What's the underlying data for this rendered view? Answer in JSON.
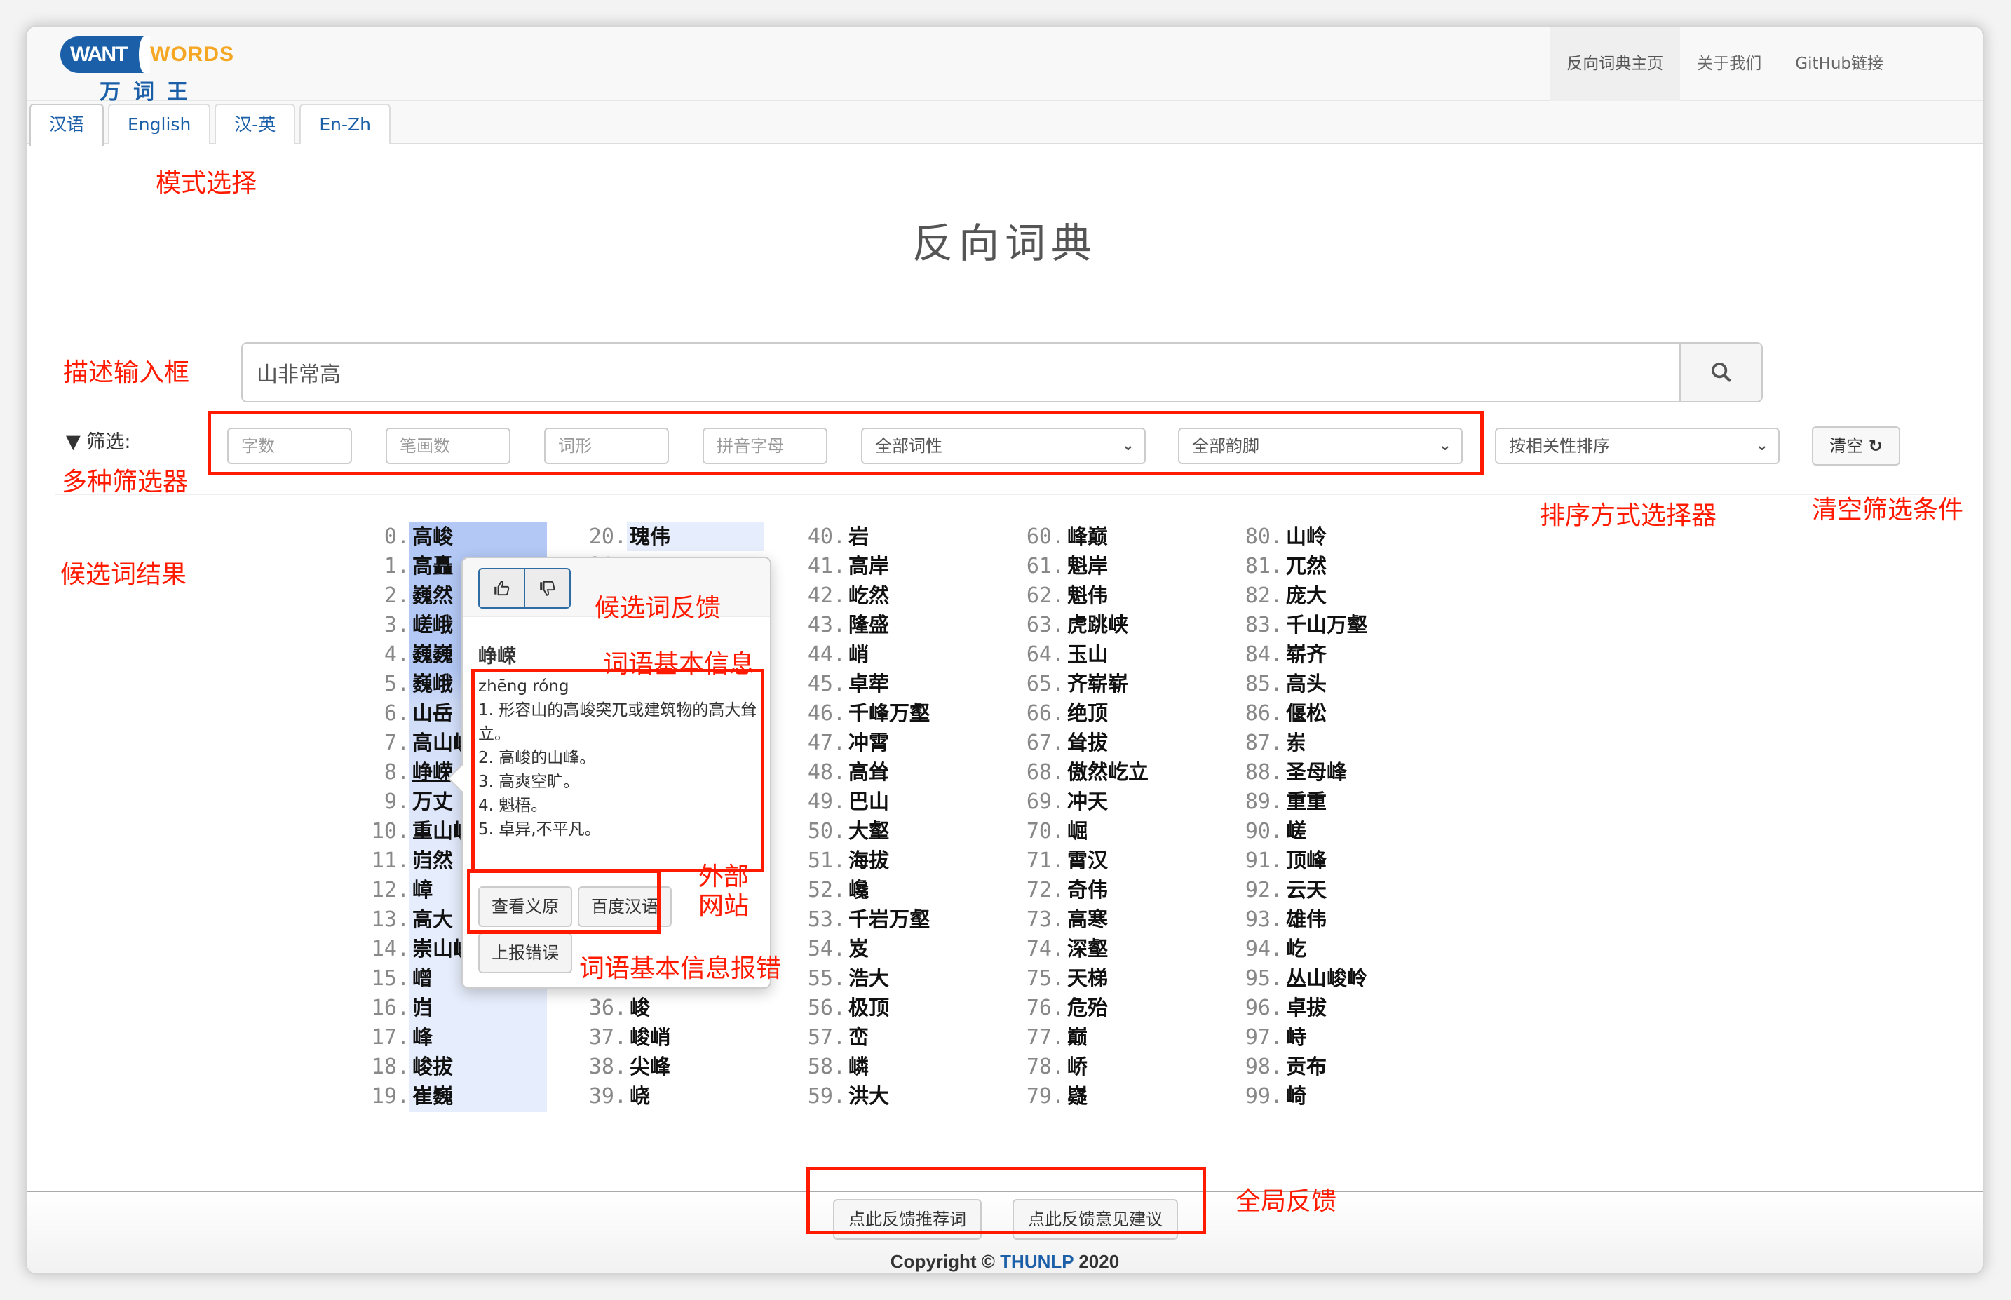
{
  "navbar": {
    "logo": {
      "word1": "WANT",
      "word2": "WORDS",
      "cn": "万词王"
    },
    "links": [
      {
        "label": "反向词典主页",
        "active": true
      },
      {
        "label": "关于我们",
        "active": false
      },
      {
        "label": "GitHub链接",
        "active": false
      }
    ]
  },
  "tabs": [
    {
      "label": "汉语",
      "active": true
    },
    {
      "label": "English",
      "active": false
    },
    {
      "label": "汉-英",
      "active": false
    },
    {
      "label": "En-Zh",
      "active": false
    }
  ],
  "page_title": "反向词典",
  "search": {
    "value": "山非常高",
    "placeholder": "",
    "icon": "search-icon"
  },
  "filters": {
    "label": "筛选:",
    "char_count_placeholder": "字数",
    "stroke_count_placeholder": "笔画数",
    "word_form_placeholder": "词形",
    "pinyin_placeholder": "拼音字母",
    "pos_select": "全部词性",
    "rhyme_select": "全部韵脚",
    "sort_select": "按相关性排序",
    "clear_label": "清空"
  },
  "results": {
    "columns": [
      [
        "高峻",
        "高矗",
        "巍然",
        "嵯峨",
        "巍巍",
        "巍峨",
        "山岳",
        "高山峻岭",
        "峥嵘",
        "万丈",
        "重山峻岭",
        "岿然",
        "嶂",
        "高大",
        "崇山峻岭",
        "嶒",
        "岿",
        "峰",
        "峻拔",
        "崔巍"
      ],
      [
        "瑰伟",
        "",
        "",
        "",
        "",
        "",
        "",
        "",
        "",
        "",
        "",
        "",
        "",
        "",
        "",
        "",
        "峻",
        "峻峭",
        "尖峰",
        "峣"
      ],
      [
        "岩",
        "高岸",
        "屹然",
        "隆盛",
        "峭",
        "卓荦",
        "千峰万壑",
        "冲霄",
        "高耸",
        "巴山",
        "大壑",
        "海拔",
        "巉",
        "千岩万壑",
        "岌",
        "浩大",
        "极顶",
        "峦",
        "嶙",
        "洪大"
      ],
      [
        "峰巅",
        "魁岸",
        "魁伟",
        "虎跳峡",
        "玉山",
        "齐崭崭",
        "绝顶",
        "耸拔",
        "傲然屹立",
        "冲天",
        "崛",
        "霄汉",
        "奇伟",
        "高寒",
        "深壑",
        "天梯",
        "危殆",
        "巅",
        "峤",
        "嶷"
      ],
      [
        "山岭",
        "兀然",
        "庞大",
        "千山万壑",
        "崭齐",
        "高头",
        "偃松",
        "岽",
        "圣母峰",
        "重重",
        "嵯",
        "顶峰",
        "云天",
        "雄伟",
        "屹",
        "丛山峻岭",
        "卓拔",
        "峙",
        "贡布",
        "崎"
      ]
    ],
    "selected_index": 8
  },
  "popover": {
    "vote_up_icon": "thumbs-up-icon",
    "vote_down_icon": "thumbs-down-icon",
    "word": "峥嵘",
    "pinyin": "zhēng róng",
    "definitions": [
      "1. 形容山的高峻突兀或建筑物的高大耸立。",
      "2. 高峻的山峰。",
      "3. 高爽空旷。",
      "4. 魁梧。",
      "5. 卓异,不平凡。"
    ],
    "source_button": "查看义原",
    "baidu_button": "百度汉语",
    "report_button": "上报错误"
  },
  "footer": {
    "feedback_words_button": "点此反馈推荐词",
    "feedback_suggestion_button": "点此反馈意见建议",
    "copyright_prefix": "Copyright © ",
    "copyright_brand": "THUNLP",
    "copyright_suffix": " 2020"
  },
  "annotations": {
    "mode_select": "模式选择",
    "description_input": "描述输入框",
    "filters": "多种筛选器",
    "results": "候选词结果",
    "candidate_feedback": "候选词反馈",
    "word_info": "词语基本信息",
    "external_sites": "外部\n网站",
    "info_report": "词语基本信息报错",
    "sort_selector": "排序方式选择器",
    "clear_filters": "清空筛选条件",
    "global_feedback": "全局反馈"
  },
  "colors": {
    "brand_blue": "#1a5fa8",
    "brand_orange": "#f5a623",
    "annotation_red": "#ff1a00",
    "highlight_strong": "#b3c8f5",
    "highlight_light": "#e6edfc"
  }
}
